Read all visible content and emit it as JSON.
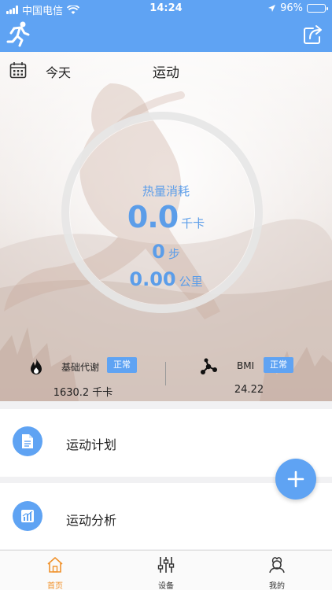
{
  "status_bar": {
    "carrier": "中国电信",
    "time": "14:24",
    "battery": "96%",
    "battery_level": 0.96
  },
  "header": {
    "runner_icon": "runner-icon",
    "share_icon": "share-icon"
  },
  "hero": {
    "date_label": "今天",
    "title": "运动",
    "calories_label": "热量消耗",
    "calories_value": "0.0",
    "calories_unit": "千卡",
    "steps_value": "0",
    "steps_unit": "步",
    "distance_value": "0.00",
    "distance_unit": "公里"
  },
  "stats": {
    "bmr": {
      "label": "基础代谢",
      "status": "正常",
      "value": "1630.2 千卡",
      "icon": "flame-icon"
    },
    "bmi": {
      "label": "BMI",
      "status": "正常",
      "value": "24.22",
      "icon": "molecule-icon"
    }
  },
  "list": [
    {
      "label": "运动计划",
      "icon": "document-icon"
    },
    {
      "label": "运动分析",
      "icon": "chart-icon"
    }
  ],
  "tabs": [
    {
      "label": "首页",
      "icon": "home-icon",
      "active": true
    },
    {
      "label": "设备",
      "icon": "sliders-icon",
      "active": false
    },
    {
      "label": "我的",
      "icon": "profile-icon",
      "active": false
    }
  ],
  "colors": {
    "primary": "#5fa3f3",
    "active_tab": "#f0922c",
    "ring_text": "#5b9de9"
  }
}
